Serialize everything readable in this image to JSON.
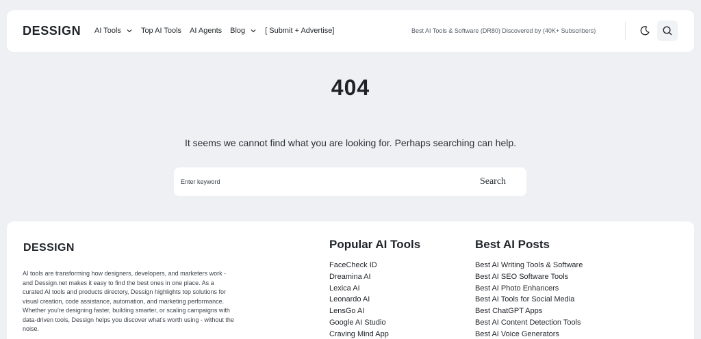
{
  "header": {
    "logo": "DESSIGN",
    "nav": [
      {
        "label": "AI Tools",
        "has_dropdown": true
      },
      {
        "label": "Top AI Tools",
        "has_dropdown": false
      },
      {
        "label": "AI Agents",
        "has_dropdown": false
      },
      {
        "label": "Blog",
        "has_dropdown": true
      },
      {
        "label": "[ Submit + Advertise]",
        "has_dropdown": false
      }
    ],
    "tagline": "Best AI Tools & Software (DR80) Discovered by (40K+ Subscribers)",
    "icons": {
      "theme": "moon-icon",
      "search": "search-icon"
    }
  },
  "main": {
    "error_code": "404",
    "message": "It seems we cannot find what you are looking for. Perhaps searching can help.",
    "search": {
      "placeholder": "Enter keyword",
      "value": "",
      "button_label": "Search"
    }
  },
  "footer": {
    "logo": "DESSIGN",
    "description": "AI tools are transforming how designers, developers, and marketers work - and Dessign.net makes it easy to find the best ones in one place. As a curated AI tools and products directory, Dessign highlights top solutions for visual creation, code assistance, automation, and marketing performance. Whether you're designing faster, building smarter, or scaling campaigns with data-driven tools, Dessign helps you discover what's worth using - without the noise.",
    "popular_tools": {
      "title": "Popular AI Tools",
      "items": [
        "FaceCheck ID",
        "Dreamina AI",
        "Lexica AI",
        "Leonardo AI",
        "LensGo AI",
        "Google AI Studio",
        "Craving Mind App"
      ]
    },
    "best_posts": {
      "title": "Best AI Posts",
      "items": [
        "Best AI Writing Tools & Software",
        "Best AI SEO Software Tools",
        "Best AI Photo Enhancers",
        "Best AI Tools for Social Media",
        "Best ChatGPT Apps",
        "Best AI Content Detection Tools",
        "Best AI Voice Generators"
      ]
    }
  },
  "colors": {
    "background": "#eef0f4",
    "card": "#ffffff",
    "text": "#1f2328"
  }
}
